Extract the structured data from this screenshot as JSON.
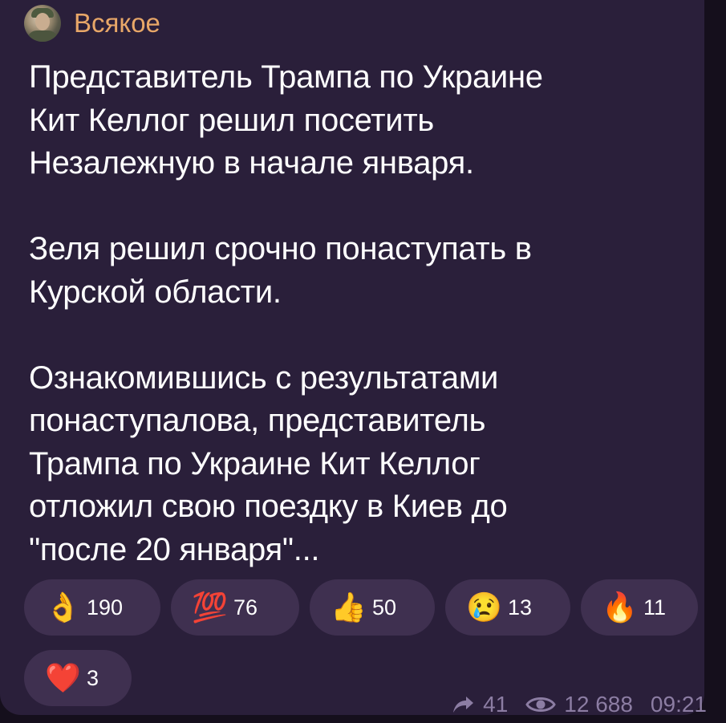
{
  "channel": {
    "name": "Всякое",
    "avatar": "avatar-photo"
  },
  "message": {
    "paragraphs": [
      "Представитель Трампа по Украине\nКит Келлог решил посетить\nНезалежную в начале января.",
      "Зеля решил срочно понаступать в\nКурской области.",
      "Ознакомившись с результатами\nпонаступалова, представитель\nТрампа по Украине Кит Келлог\nотложил свою поездку в Киев до\n\"после 20 января\"..."
    ]
  },
  "reactions": [
    {
      "emoji": "👌",
      "count": "190"
    },
    {
      "emoji": "💯",
      "count": "76"
    },
    {
      "emoji": "👍",
      "count": "50"
    },
    {
      "emoji": "😢",
      "count": "13"
    },
    {
      "emoji": "🔥",
      "count": "11"
    },
    {
      "emoji": "❤️",
      "count": "3"
    }
  ],
  "meta": {
    "forwards": "41",
    "views": "12 688",
    "time": "09:21",
    "forward_icon": "forward-arrow-icon",
    "views_icon": "eye-icon"
  },
  "colors": {
    "background": "#150f1c",
    "bubble": "#2a1f3a",
    "channel_name": "#e8a768",
    "reaction_pill": "#3f3050",
    "meta_text": "#8c7da3"
  }
}
